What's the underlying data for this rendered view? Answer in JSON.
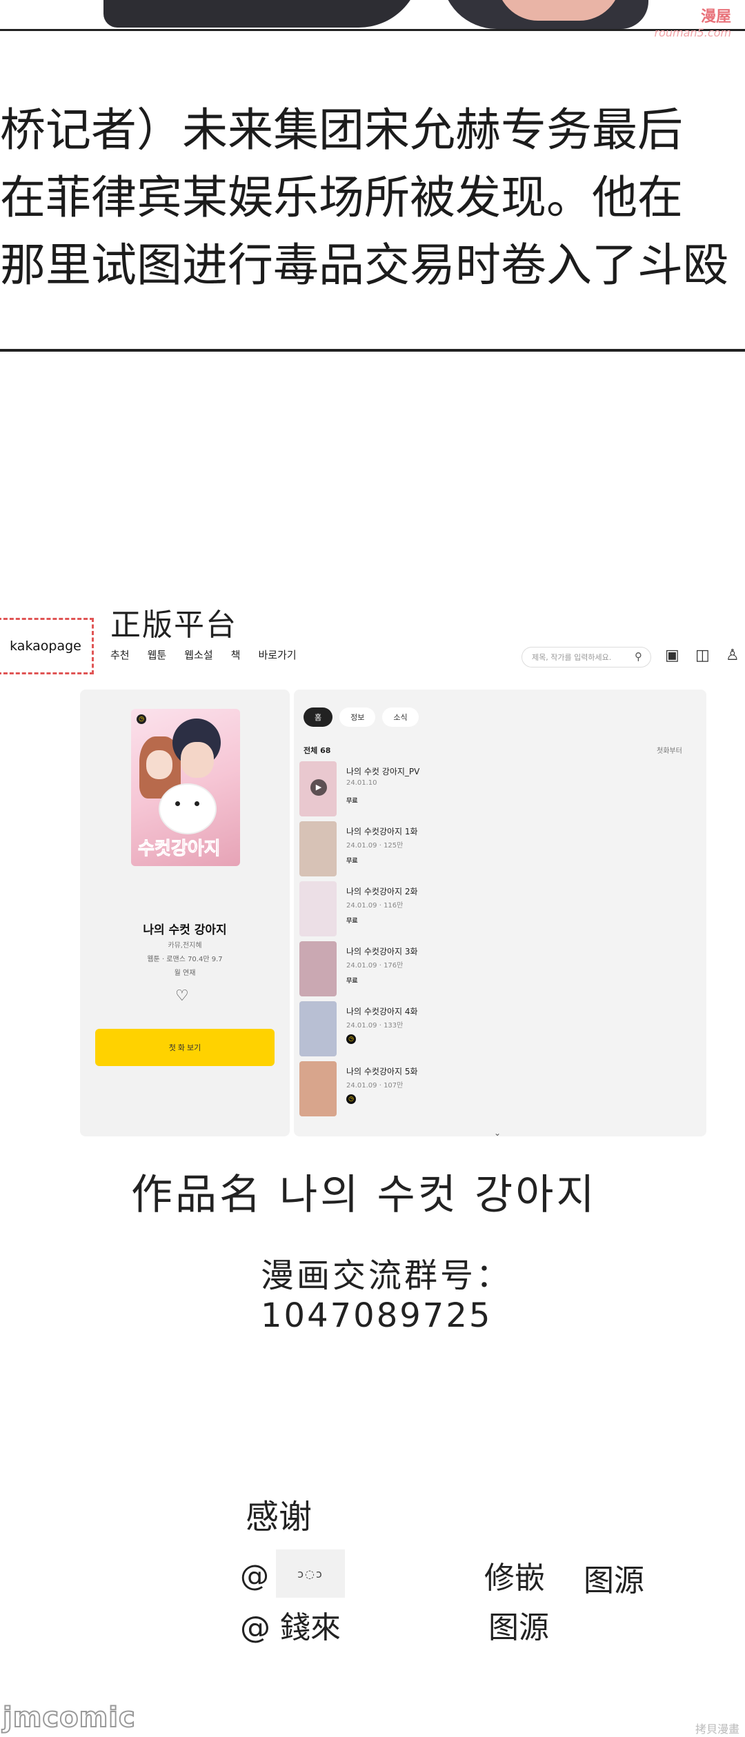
{
  "watermark": {
    "line1": "漫屋",
    "line2": "rouman5.com"
  },
  "narration": [
    "桥记者）未来集团宋允赫专务最后",
    "在菲律宾某娱乐场所被发现。他在",
    "那里试图进行毒品交易时卷入了斗殴"
  ],
  "platform": {
    "title": "正版平台",
    "logo": "kakaopage",
    "nav": [
      "추천",
      "웹툰",
      "웹소설",
      "책",
      "바로가기"
    ],
    "search_placeholder": "제목, 작가를 입력하세요.",
    "icons": [
      "search-icon",
      "box-icon",
      "book-icon",
      "user-icon"
    ]
  },
  "work": {
    "title": "나의 수컷 강아지",
    "author": "카뮤,전지혜",
    "meta": "웹툰 · 로맨스   70.4만   9.7",
    "status": "월 연재",
    "cover_text": "수컷강아지",
    "read_button": "첫 화 보기"
  },
  "episode_panel": {
    "tabs": [
      "홈",
      "정보",
      "소식"
    ],
    "total": "전체 68",
    "sort": "첫화부터",
    "episodes": [
      {
        "name": "나의 수컷 강아지_PV",
        "date": "24.01.10",
        "tag": "무료",
        "color": "#e9c8cf"
      },
      {
        "name": "나의 수컷강아지 1화",
        "date": "24.01.09 · 125만",
        "tag": "무료",
        "color": "#d7c2b6"
      },
      {
        "name": "나의 수컷강아지 2화",
        "date": "24.01.09 · 116만",
        "tag": "무료",
        "color": "#ecdfe6"
      },
      {
        "name": "나의 수컷강아지 3화",
        "date": "24.01.09 · 176만",
        "tag": "무료",
        "color": "#caa8b2"
      },
      {
        "name": "나의 수컷강아지 4화",
        "date": "24.01.09 · 133만",
        "tag": "",
        "color": "#b8bfd3"
      },
      {
        "name": "나의 수컷강아지 5화",
        "date": "24.01.09 · 107만",
        "tag": "",
        "color": "#d8a58c"
      }
    ]
  },
  "credits": {
    "work_name": "作品名  나의 수컷 강아지",
    "group_label": "漫画交流群号：",
    "group_number": "1047089725",
    "thanks": "感谢",
    "at1": "@",
    "credit_img_text": "ↄ◌ↄ",
    "role1a": "修嵌",
    "role1b": "图源",
    "at2": "@ 錢來",
    "role2": "图源"
  },
  "footer": {
    "logo": "jmcomic",
    "watermark": "拷貝漫畫"
  }
}
